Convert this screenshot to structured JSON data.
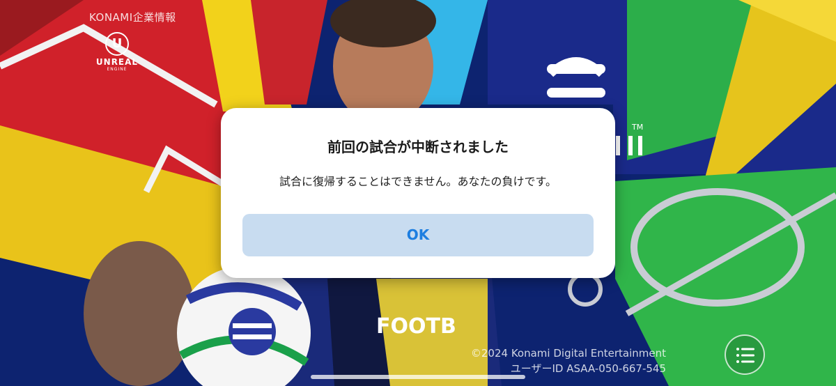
{
  "header": {
    "konami_link": "KONAMI企業情報",
    "engine_logo": {
      "word": "UNREAL",
      "sub": "ENGINE"
    }
  },
  "dialog": {
    "title": "前回の試合が中断されました",
    "message": "試合に復帰することはできません。あなたの負けです。",
    "ok_label": "OK"
  },
  "footer": {
    "copyright": "©2024 Konami Digital Entertainment",
    "user_id": "ユーザーID ASAA-050-667-545"
  },
  "icons": {
    "menu": "menu-list-icon",
    "unreal": "unreal-engine-logo"
  },
  "colors": {
    "ok_button_bg": "#c8dcf0",
    "ok_button_text": "#1d7ee0",
    "background_blue": "#0b1f6b"
  }
}
